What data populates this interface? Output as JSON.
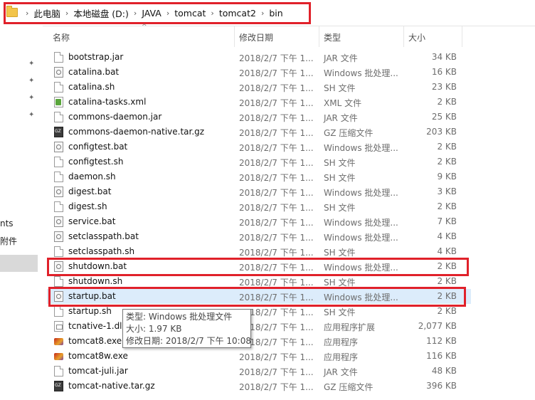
{
  "address_bar": {
    "breadcrumbs": [
      "此电脑",
      "本地磁盘 (D:)",
      "JAVA",
      "tomcat",
      "tomcat2",
      "bin"
    ]
  },
  "nav_pane": {
    "partial_items": [
      "nts",
      "附件"
    ]
  },
  "columns": {
    "name": "名称",
    "modified": "修改日期",
    "type": "类型",
    "size": "大小"
  },
  "files": [
    {
      "name": "bootstrap.jar",
      "date": "2018/2/7 下午 1...",
      "type": "JAR 文件",
      "size": "34 KB",
      "icon": "file-icon"
    },
    {
      "name": "catalina.bat",
      "date": "2018/2/7 下午 1...",
      "type": "Windows 批处理...",
      "size": "16 KB",
      "icon": "bat-icon"
    },
    {
      "name": "catalina.sh",
      "date": "2018/2/7 下午 1...",
      "type": "SH 文件",
      "size": "23 KB",
      "icon": "file-icon"
    },
    {
      "name": "catalina-tasks.xml",
      "date": "2018/2/7 下午 1...",
      "type": "XML 文件",
      "size": "2 KB",
      "icon": "xml-icon"
    },
    {
      "name": "commons-daemon.jar",
      "date": "2018/2/7 下午 1...",
      "type": "JAR 文件",
      "size": "25 KB",
      "icon": "file-icon"
    },
    {
      "name": "commons-daemon-native.tar.gz",
      "date": "2018/2/7 下午 1...",
      "type": "GZ 压缩文件",
      "size": "203 KB",
      "icon": "gz-icon"
    },
    {
      "name": "configtest.bat",
      "date": "2018/2/7 下午 1...",
      "type": "Windows 批处理...",
      "size": "2 KB",
      "icon": "bat-icon"
    },
    {
      "name": "configtest.sh",
      "date": "2018/2/7 下午 1...",
      "type": "SH 文件",
      "size": "2 KB",
      "icon": "file-icon"
    },
    {
      "name": "daemon.sh",
      "date": "2018/2/7 下午 1...",
      "type": "SH 文件",
      "size": "9 KB",
      "icon": "file-icon"
    },
    {
      "name": "digest.bat",
      "date": "2018/2/7 下午 1...",
      "type": "Windows 批处理...",
      "size": "3 KB",
      "icon": "bat-icon"
    },
    {
      "name": "digest.sh",
      "date": "2018/2/7 下午 1...",
      "type": "SH 文件",
      "size": "2 KB",
      "icon": "file-icon"
    },
    {
      "name": "service.bat",
      "date": "2018/2/7 下午 1...",
      "type": "Windows 批处理...",
      "size": "7 KB",
      "icon": "bat-icon"
    },
    {
      "name": "setclasspath.bat",
      "date": "2018/2/7 下午 1...",
      "type": "Windows 批处理...",
      "size": "4 KB",
      "icon": "bat-icon"
    },
    {
      "name": "setclasspath.sh",
      "date": "2018/2/7 下午 1...",
      "type": "SH 文件",
      "size": "4 KB",
      "icon": "file-icon"
    },
    {
      "name": "shutdown.bat",
      "date": "2018/2/7 下午 1...",
      "type": "Windows 批处理...",
      "size": "2 KB",
      "icon": "bat-icon"
    },
    {
      "name": "shutdown.sh",
      "date": "2018/2/7 下午 1...",
      "type": "SH 文件",
      "size": "2 KB",
      "icon": "file-icon"
    },
    {
      "name": "startup.bat",
      "date": "2018/2/7 下午 1...",
      "type": "Windows 批处理...",
      "size": "2 KB",
      "icon": "bat-icon"
    },
    {
      "name": "startup.sh",
      "date": "2018/2/7 下午 1...",
      "type": "SH 文件",
      "size": "2 KB",
      "icon": "file-icon"
    },
    {
      "name": "tcnative-1.dll",
      "date": "2018/2/7 下午 1...",
      "type": "应用程序扩展",
      "size": "2,077 KB",
      "icon": "dll-icon"
    },
    {
      "name": "tomcat8.exe",
      "date": "2018/2/7 下午 1...",
      "type": "应用程序",
      "size": "112 KB",
      "icon": "exe-icon"
    },
    {
      "name": "tomcat8w.exe",
      "date": "2018/2/7 下午 1...",
      "type": "应用程序",
      "size": "116 KB",
      "icon": "exe-icon"
    },
    {
      "name": "tomcat-juli.jar",
      "date": "2018/2/7 下午 1...",
      "type": "JAR 文件",
      "size": "48 KB",
      "icon": "file-icon"
    },
    {
      "name": "tomcat-native.tar.gz",
      "date": "2018/2/7 下午 1...",
      "type": "GZ 压缩文件",
      "size": "396 KB",
      "icon": "gz-icon"
    }
  ],
  "hovered_file": "startup.bat",
  "tooltip": {
    "type_line": "类型: Windows 批处理文件",
    "size_line": "大小: 1.97 KB",
    "date_line": "修改日期: 2018/2/7 下午 10:08"
  },
  "colors": {
    "annotation_red": "#e0212a",
    "hover_blue": "#dcecfb"
  }
}
